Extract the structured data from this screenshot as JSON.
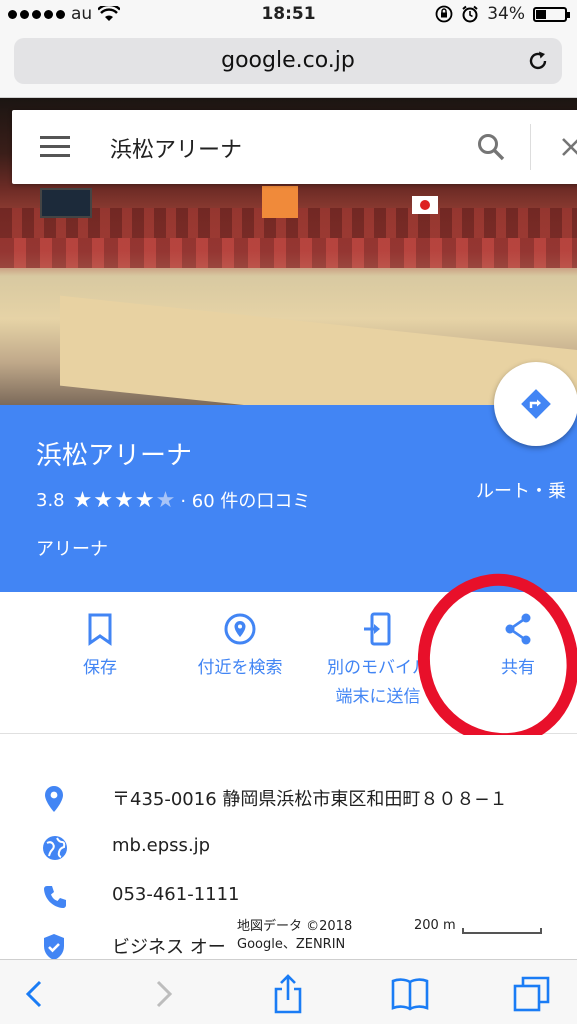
{
  "status_bar": {
    "carrier": "au",
    "time": "18:51",
    "battery": "34%",
    "battery_level": 0.34
  },
  "browser": {
    "url": "google.co.jp"
  },
  "search": {
    "query": "浜松アリーナ"
  },
  "place": {
    "name": "浜松アリーナ",
    "rating": "3.8",
    "stars_filled": 4,
    "stars_total": 5,
    "reviews": "· 60 件の口コミ",
    "category": "アリーナ",
    "route_label": "ルート・乗"
  },
  "actions": [
    {
      "label": "保存",
      "icon": "bookmark-icon"
    },
    {
      "label": "付近を検索",
      "icon": "nearby-search-icon"
    },
    {
      "label_line1": "別のモバイル",
      "label_line2": "端末に送信",
      "icon": "send-to-device-icon"
    },
    {
      "label": "共有",
      "icon": "share-icon"
    }
  ],
  "details": {
    "address": "〒435-0016 静岡県浜松市東区和田町８０８−１",
    "website": "mb.epss.jp",
    "phone": "053-461-1111",
    "business": "ビジネス オー"
  },
  "map": {
    "attribution_line1": "地図データ ©2018",
    "attribution_line2": "Google、ZENRIN",
    "scale": "200 m"
  },
  "colors": {
    "accent": "#4285f4",
    "annotation": "#e8102a"
  }
}
